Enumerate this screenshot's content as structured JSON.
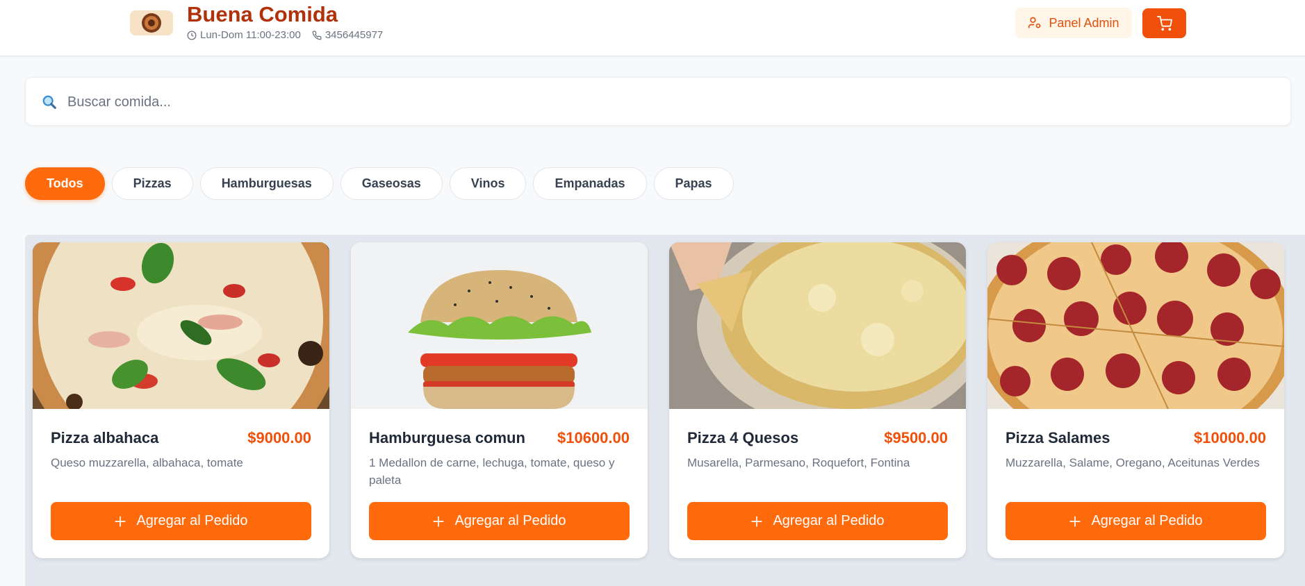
{
  "header": {
    "title": "Buena Comida",
    "hours": "Lun-Dom 11:00-23:00",
    "phone": "3456445977",
    "admin_label": "Panel Admin"
  },
  "search": {
    "placeholder": "Buscar comida..."
  },
  "categories": [
    "Todos",
    "Pizzas",
    "Hamburguesas",
    "Gaseosas",
    "Vinos",
    "Empanadas",
    "Papas"
  ],
  "active_category": "Todos",
  "colors": {
    "accent": "#ff6a0d",
    "brand": "#b0310a",
    "price": "#f0500a"
  },
  "products": [
    {
      "name": "Pizza albahaca",
      "price": "$9000.00",
      "description": "Queso muzzarella, albahaca, tomate",
      "button": "Agregar al Pedido"
    },
    {
      "name": "Hamburguesa comun",
      "price": "$10600.00",
      "description": "1 Medallon de carne, lechuga, tomate, queso y paleta",
      "button": "Agregar al Pedido"
    },
    {
      "name": "Pizza 4 Quesos",
      "price": "$9500.00",
      "description": "Musarella, Parmesano, Roquefort, Fontina",
      "button": "Agregar al Pedido"
    },
    {
      "name": "Pizza Salames",
      "price": "$10000.00",
      "description": "Muzzarella, Salame, Oregano, Aceitunas Verdes",
      "button": "Agregar al Pedido"
    }
  ]
}
